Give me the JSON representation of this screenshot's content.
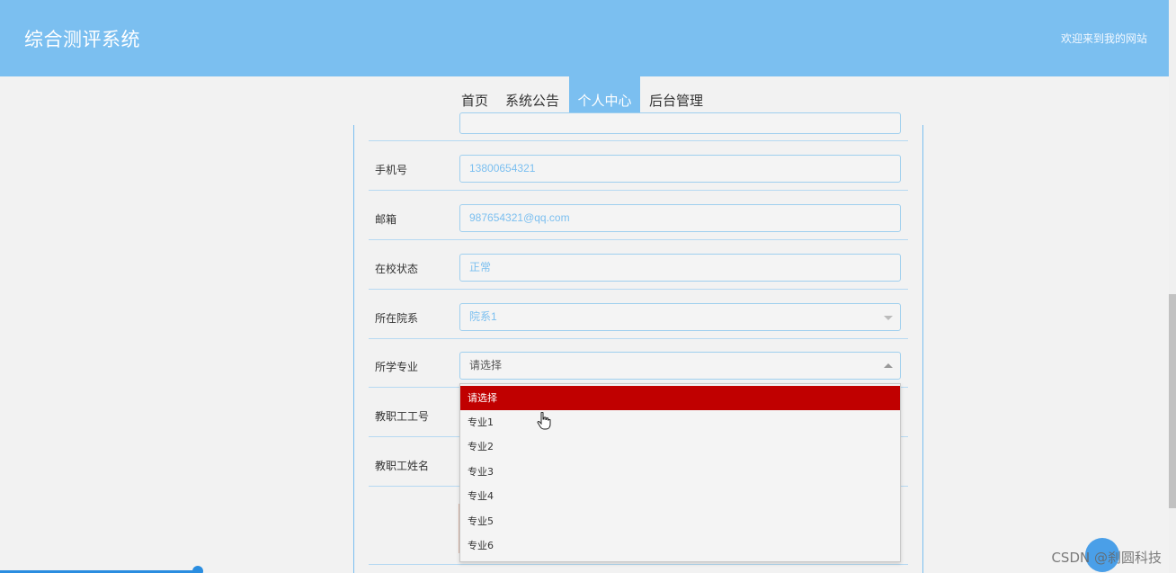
{
  "header": {
    "site_title": "综合测评系统",
    "welcome": "欢迎来到我的网站",
    "background_color": "#7bbff0"
  },
  "nav": {
    "items": [
      {
        "label": "首页",
        "active": false
      },
      {
        "label": "系统公告",
        "active": false
      },
      {
        "label": "个人中心",
        "active": true
      },
      {
        "label": "后台管理",
        "active": false
      }
    ]
  },
  "form": {
    "rows": [
      {
        "label": "手机号",
        "value": "13800654321"
      },
      {
        "label": "邮箱",
        "value": "987654321@qq.com"
      },
      {
        "label": "在校状态",
        "value": "正常"
      },
      {
        "label": "所在院系",
        "value": "院系1",
        "type": "select"
      },
      {
        "label": "所学专业",
        "value": "请选择",
        "type": "select",
        "open": true
      },
      {
        "label": "教职工工号"
      },
      {
        "label": "教职工姓名"
      }
    ]
  },
  "dropdown": {
    "options": [
      "请选择",
      "专业1",
      "专业2",
      "专业3",
      "专业4",
      "专业5",
      "专业6"
    ],
    "selected": "请选择",
    "highlight_color": "#c00000"
  },
  "watermark": {
    "text": "CSDN @刹圆科技"
  },
  "icons": {
    "cursor": "hand-pointer-icon",
    "select_caret_down": "caret-down-icon",
    "select_caret_up": "caret-up-icon"
  }
}
